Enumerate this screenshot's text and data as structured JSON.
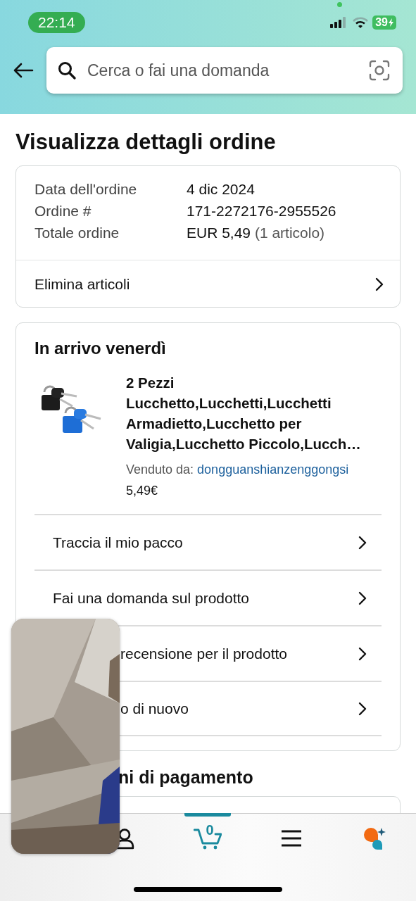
{
  "status_bar": {
    "time": "22:14",
    "battery": "39"
  },
  "search": {
    "placeholder": "Cerca o fai una domanda"
  },
  "page_title": "Visualizza dettagli ordine",
  "order_summary": {
    "rows": [
      {
        "label": "Data dell'ordine",
        "value": "4 dic 2024"
      },
      {
        "label": "Ordine #",
        "value": "171-2272176-2955526"
      },
      {
        "label": "Totale ordine",
        "value": "EUR 5,49",
        "note": "(1 articolo)"
      }
    ],
    "action": "Elimina articoli"
  },
  "shipment": {
    "heading": "In arrivo venerdì",
    "product": {
      "title": "2 Pezzi Lucchetto,Lucchetti,Lucchetti Armadietto,Lucchetto per Valigia,Lucchetto Piccolo,Lucch…",
      "seller_label": "Venduto da:",
      "seller": "dongguanshianzenggongsi",
      "price": "5,49€"
    },
    "actions": [
      {
        "label": "Traccia il mio pacco",
        "covered": false
      },
      {
        "label": "Fai una domanda sul prodotto",
        "covered": false
      },
      {
        "label": "recensione per il prodotto",
        "covered": true
      },
      {
        "label": "o di nuovo",
        "covered": true
      }
    ]
  },
  "payment_heading": "ni di pagamento",
  "bottom_nav": [
    {
      "kind": "profile",
      "selected": false
    },
    {
      "kind": "cart",
      "selected": true,
      "badge": "0"
    },
    {
      "kind": "menu",
      "selected": false
    },
    {
      "kind": "assistant",
      "selected": false
    }
  ]
}
